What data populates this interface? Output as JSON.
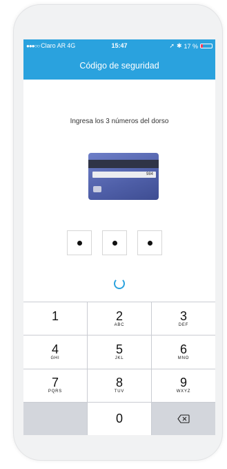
{
  "status_bar": {
    "carrier": "Claro AR",
    "network": "4G",
    "time": "15:47",
    "battery": "17 %",
    "battery_level": 0.17
  },
  "header": {
    "title": "Código de seguridad"
  },
  "main": {
    "instruction": "Ingresa los 3 números del dorso",
    "card_code": "984",
    "pin_digits": 3
  },
  "keypad": {
    "keys": [
      {
        "num": "1",
        "letters": ""
      },
      {
        "num": "2",
        "letters": "ABC"
      },
      {
        "num": "3",
        "letters": "DEF"
      },
      {
        "num": "4",
        "letters": "GHI"
      },
      {
        "num": "5",
        "letters": "JKL"
      },
      {
        "num": "6",
        "letters": "MNO"
      },
      {
        "num": "7",
        "letters": "PQRS"
      },
      {
        "num": "8",
        "letters": "TUV"
      },
      {
        "num": "9",
        "letters": "WXYZ"
      },
      {
        "num": "0",
        "letters": ""
      }
    ]
  },
  "colors": {
    "accent": "#2aa2de",
    "battery_low": "#ff3b5c"
  }
}
